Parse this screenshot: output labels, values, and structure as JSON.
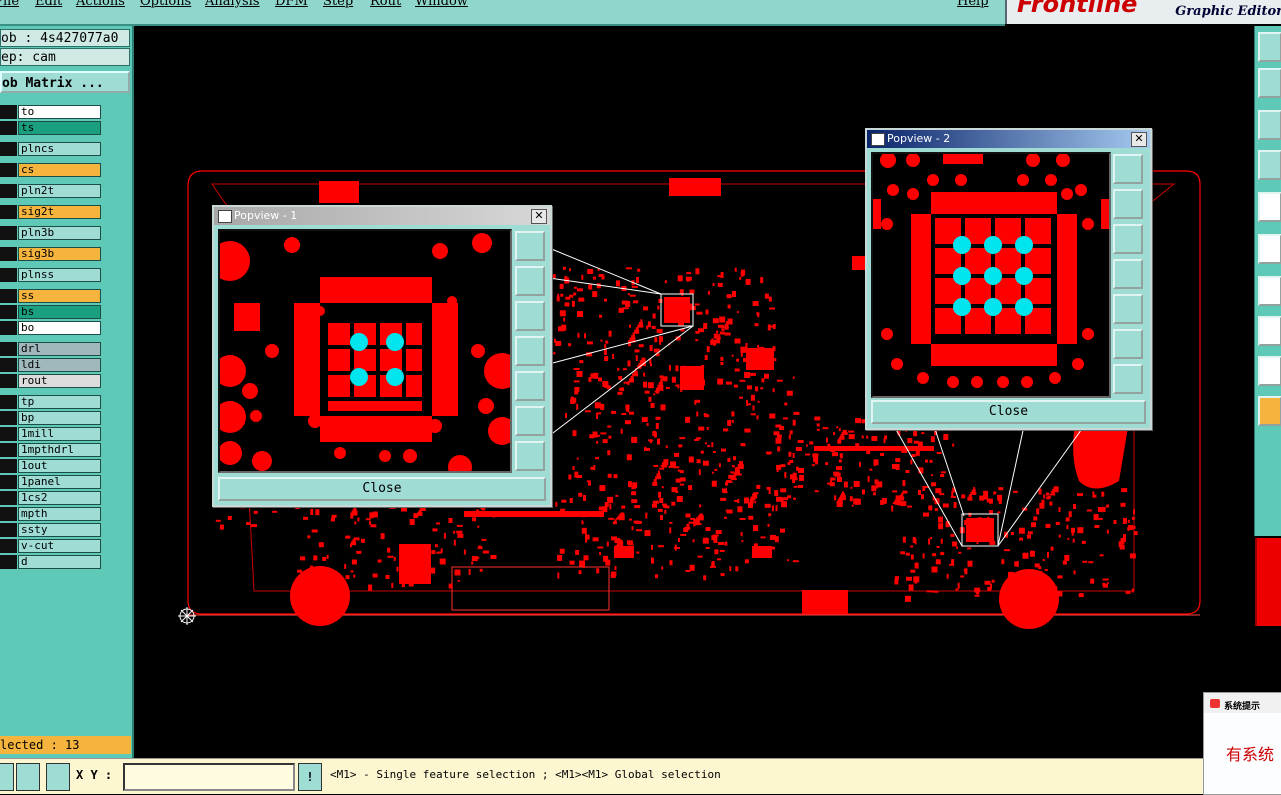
{
  "menu": [
    "File",
    "Edit",
    "Actions",
    "Options",
    "Analysis",
    "DFM",
    "Step",
    "Rout",
    "Window"
  ],
  "menu_help": "Help",
  "brand": {
    "logo": "Frontline",
    "subtitle": "Graphic Editor"
  },
  "job": {
    "job_label": "ob : 4s427077a0",
    "step_label": "ep: cam",
    "matrix_button": "ob Matrix ..."
  },
  "layers": [
    {
      "name": "to",
      "color": "#ffffff"
    },
    {
      "name": "ts",
      "color": "#1aa07e"
    },
    {
      "name": "plncs",
      "color": "#9fdcd4"
    },
    {
      "name": "cs",
      "color": "#f5b43d"
    },
    {
      "name": "pln2t",
      "color": "#9fdcd4"
    },
    {
      "name": "sig2t",
      "color": "#f5b43d"
    },
    {
      "name": "pln3b",
      "color": "#9fdcd4"
    },
    {
      "name": "sig3b",
      "color": "#f5b43d"
    },
    {
      "name": "plnss",
      "color": "#9fdcd4"
    },
    {
      "name": "ss",
      "color": "#f5b43d"
    },
    {
      "name": "bs",
      "color": "#1aa07e"
    },
    {
      "name": "bo",
      "color": "#ffffff"
    },
    {
      "name": "drl",
      "color": "#a0b8bc"
    },
    {
      "name": "ldi",
      "color": "#a0b8bc"
    },
    {
      "name": "rout",
      "color": "#dcdcdc"
    },
    {
      "name": "tp",
      "color": "#9fdcd4"
    },
    {
      "name": "bp",
      "color": "#9fdcd4"
    },
    {
      "name": "1mill",
      "color": "#9fdcd4"
    },
    {
      "name": "1mpthdrl",
      "color": "#9fdcd4"
    },
    {
      "name": "1out",
      "color": "#9fdcd4"
    },
    {
      "name": "1panel",
      "color": "#9fdcd4"
    },
    {
      "name": "1cs2",
      "color": "#9fdcd4"
    },
    {
      "name": "mpth",
      "color": "#9fdcd4"
    },
    {
      "name": "ssty",
      "color": "#9fdcd4"
    },
    {
      "name": "v-cut",
      "color": "#9fdcd4"
    },
    {
      "name": "d",
      "color": "#9fdcd4"
    }
  ],
  "status": {
    "selected": "lected : 13"
  },
  "bottom": {
    "xy_label": "X Y :",
    "xy_value": "",
    "excl": "!",
    "help": "<M1> - Single feature selection ; <M1><M1> Global selection"
  },
  "popview1": {
    "title": "Popview - 1",
    "close": "Close",
    "close_x": "✕"
  },
  "popview2": {
    "title": "Popview - 2",
    "close": "Close",
    "close_x": "✕"
  },
  "dialog": {
    "title": "系统提示",
    "text": "有系统"
  },
  "colors": {
    "copper": "#ff0000",
    "via": "#00e5ee",
    "panel": "#5fc9b8",
    "button": "#9fdcd4"
  }
}
